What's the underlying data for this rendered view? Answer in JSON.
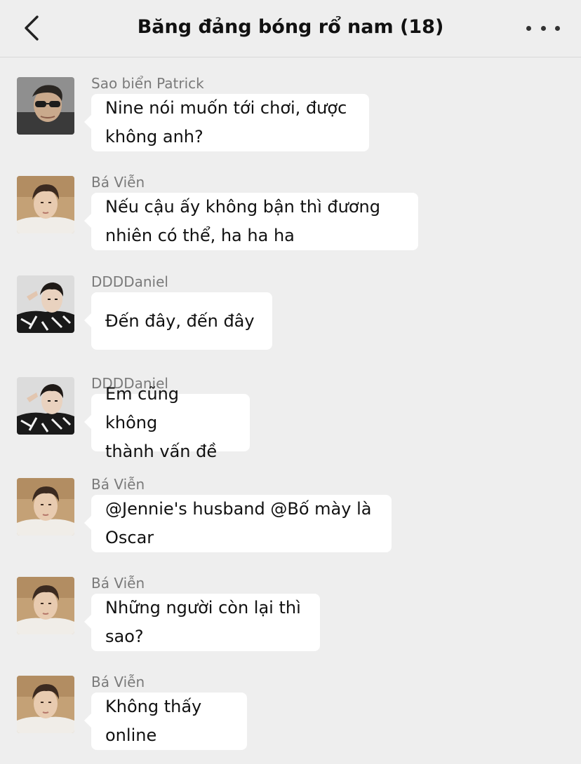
{
  "header": {
    "title": "Băng đảng bóng rổ nam (18)",
    "back_icon": "chevron-left-icon",
    "more_icon": "more-horizontal-icon"
  },
  "messages": [
    {
      "sender": "Sao biển Patrick",
      "avatar": "patrick",
      "text": "Nine nói muốn tới chơi, được\nkhông anh?"
    },
    {
      "sender": "Bá Viễn",
      "avatar": "bavien",
      "text": "Nếu cậu ấy không bận thì đương\nnhiên có thể, ha ha ha"
    },
    {
      "sender": "DDDDaniel",
      "avatar": "daniel",
      "text": "Đến đây, đến đây"
    },
    {
      "sender": "DDDDaniel",
      "avatar": "daniel",
      "text": "Em cũng không\nthành vấn đề"
    },
    {
      "sender": "Bá Viễn",
      "avatar": "bavien",
      "text": "@Jennie's husband @Bố mày là\nOscar"
    },
    {
      "sender": "Bá Viễn",
      "avatar": "bavien",
      "text": "Những người còn lại thì\nsao?"
    },
    {
      "sender": "Bá Viễn",
      "avatar": "bavien",
      "text": "Không thấy\nonline"
    }
  ],
  "colors": {
    "background": "#eeeeee",
    "bubble": "#ffffff",
    "sender_name": "#7a7a7a"
  }
}
